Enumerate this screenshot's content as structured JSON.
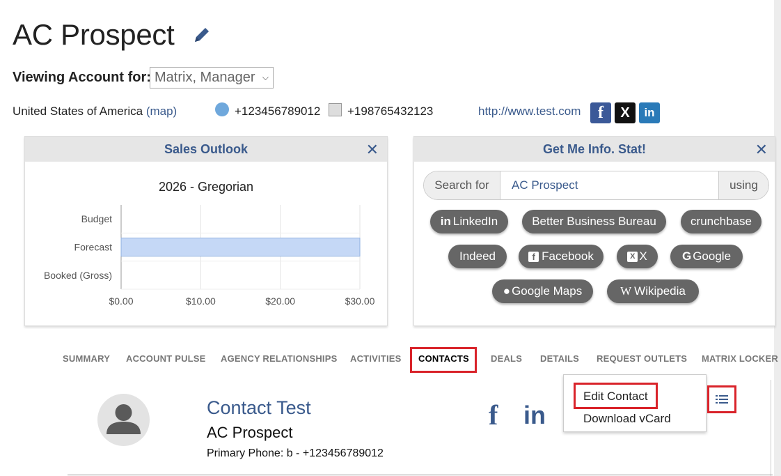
{
  "header": {
    "title": "AC Prospect",
    "viewing_label": "Viewing Account for:",
    "viewing_value": "Matrix, Manager"
  },
  "info": {
    "country": "United States of America",
    "map_link": "(map)",
    "phone": "+123456789012",
    "fax": "+198765432123",
    "website": "http://www.test.com"
  },
  "sales_outlook": {
    "title": "Sales Outlook",
    "close": "✕"
  },
  "chart_data": {
    "type": "bar",
    "orientation": "horizontal",
    "title": "2026 - Gregorian",
    "categories": [
      "Budget",
      "Forecast",
      "Booked (Gross)"
    ],
    "values": [
      0,
      30,
      0
    ],
    "xlim": [
      0,
      30
    ],
    "ticks": [
      "$0.00",
      "$10.00",
      "$20.00",
      "$30.00"
    ],
    "bar_color": "#c5d8f6",
    "grid": true
  },
  "get_info": {
    "title": "Get Me Info. Stat!",
    "close": "✕",
    "search_for": "Search for",
    "search_value": "AC Prospect",
    "using": "using",
    "pills": [
      "LinkedIn",
      "Better Business Bureau",
      "crunchbase",
      "Indeed",
      "Facebook",
      "X",
      "Google",
      "Google Maps",
      "Wikipedia"
    ]
  },
  "tabs": [
    "SUMMARY",
    "ACCOUNT PULSE",
    "AGENCY RELATIONSHIPS",
    "ACTIVITIES",
    "CONTACTS",
    "DEALS",
    "DETAILS",
    "REQUEST OUTLETS",
    "MATRIX LOCKER"
  ],
  "contact": {
    "name": "Contact Test",
    "company": "AC Prospect",
    "phone": "Primary Phone: b - +123456789012"
  },
  "dropdown": {
    "edit": "Edit Contact",
    "download": "Download vCard"
  },
  "colors": {
    "accent": "#3a5a8c",
    "highlight": "#d9232a",
    "pill": "#666666"
  }
}
